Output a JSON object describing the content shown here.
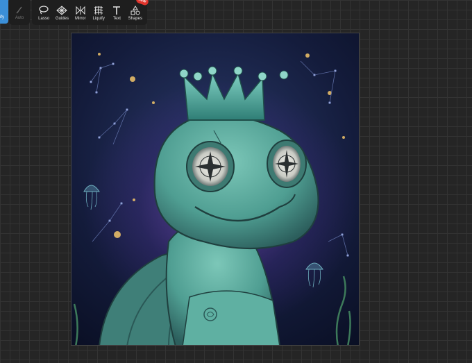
{
  "toolbar": {
    "left_tool_label": "ify",
    "secondary_tool_label": "Auto",
    "tools": [
      {
        "label": "Lasso",
        "icon": "lasso-icon"
      },
      {
        "label": "Guides",
        "icon": "guides-icon"
      },
      {
        "label": "Mirror",
        "icon": "mirror-icon"
      },
      {
        "label": "Liquify",
        "icon": "liquify-icon"
      },
      {
        "label": "Text",
        "icon": "text-icon"
      },
      {
        "label": "Shapes",
        "icon": "shapes-icon"
      }
    ],
    "new_badge": "NEW"
  },
  "colors": {
    "accent_blue": "#3b8fd8",
    "badge_red": "#e0342c",
    "turtle_teal": "#4f9e92",
    "glow_purple": "#9a55d8"
  }
}
